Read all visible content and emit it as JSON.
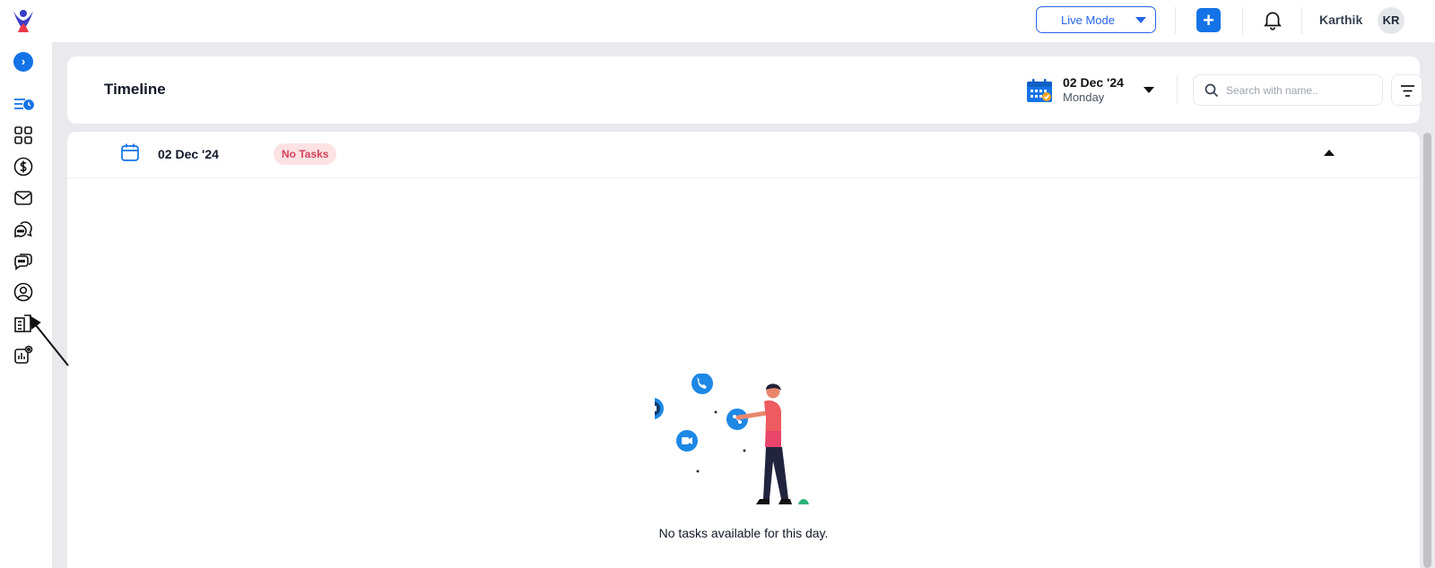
{
  "topbar": {
    "mode_label": "Live Mode",
    "add_label": "+",
    "user_name": "Karthik",
    "user_initials": "KR"
  },
  "sidebar": {
    "expand_label": "›",
    "items": [
      {
        "icon": "timeline-icon"
      },
      {
        "icon": "dashboard-grid-icon"
      },
      {
        "icon": "dollar-icon"
      },
      {
        "icon": "mail-icon"
      },
      {
        "icon": "chat-bubbles-icon"
      },
      {
        "icon": "conversation-icon"
      },
      {
        "icon": "user-circle-icon"
      },
      {
        "icon": "building-icon"
      },
      {
        "icon": "reports-settings-icon"
      }
    ]
  },
  "header": {
    "title": "Timeline",
    "date": "02 Dec '24",
    "weekday": "Monday",
    "search_placeholder": "Search with name.."
  },
  "day_group": {
    "date": "02 Dec '24",
    "badge": "No Tasks",
    "empty_message": "No tasks available for this day."
  },
  "colors": {
    "accent": "#1473e6",
    "badge_bg": "#fde2e4",
    "badge_text": "#d1435b",
    "page_bg": "#e9e9ee"
  }
}
